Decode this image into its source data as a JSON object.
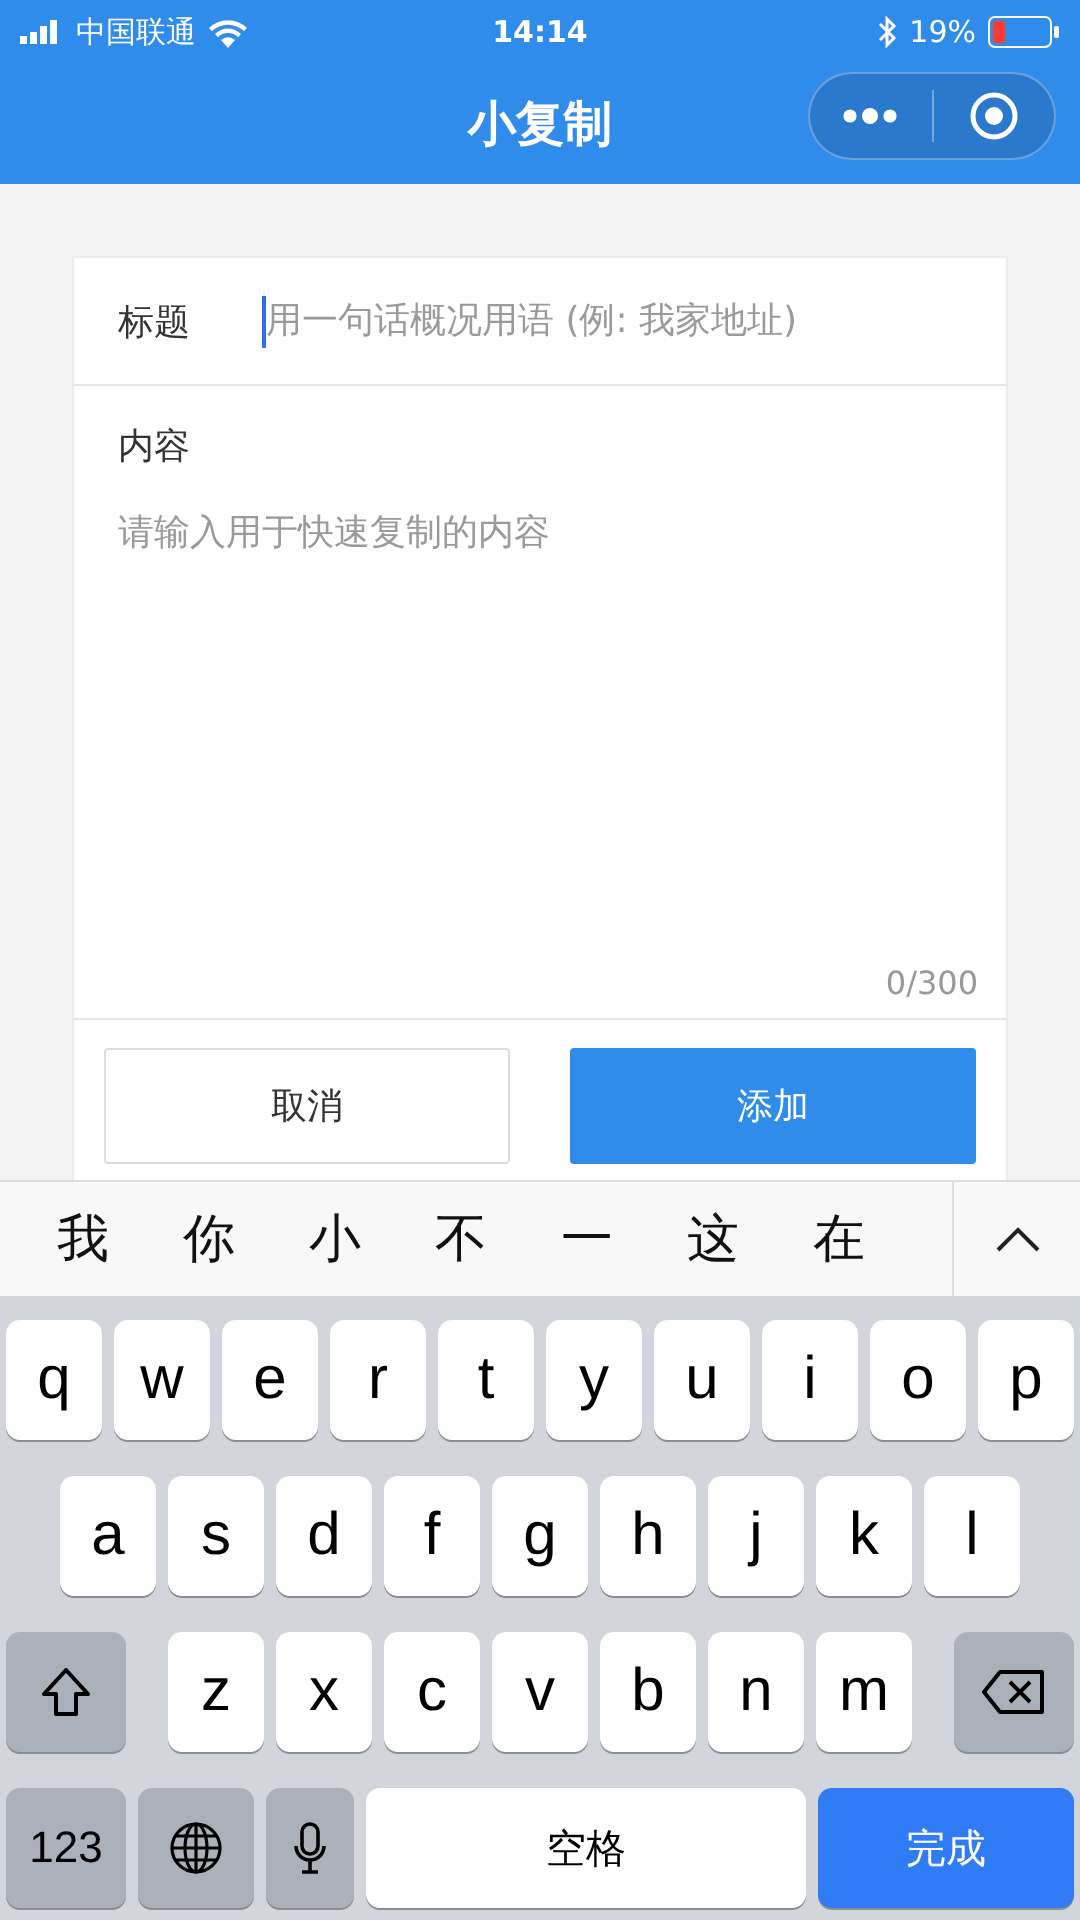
{
  "status_bar": {
    "carrier": "中国联通",
    "time": "14:14",
    "battery": "19%"
  },
  "nav": {
    "title": "小复制"
  },
  "form": {
    "title_label": "标题",
    "title_placeholder": "用一句话概况用语 (例: 我家地址)",
    "content_label": "内容",
    "content_placeholder": "请输入用于快速复制的内容",
    "counter": "0/300"
  },
  "buttons": [
    {
      "label": "取消",
      "kind": "secondary"
    },
    {
      "label": "添加",
      "kind": "primary"
    }
  ],
  "candidates": [
    "我",
    "你",
    "小",
    "不",
    "一",
    "这",
    "在"
  ],
  "keyboard": {
    "rows": [
      [
        "q",
        "w",
        "e",
        "r",
        "t",
        "y",
        "u",
        "i",
        "o",
        "p"
      ],
      [
        "a",
        "s",
        "d",
        "f",
        "g",
        "h",
        "j",
        "k",
        "l"
      ],
      [
        "z",
        "x",
        "c",
        "v",
        "b",
        "n",
        "m"
      ]
    ],
    "numbers": "123",
    "space": "空格",
    "done": "完成"
  }
}
